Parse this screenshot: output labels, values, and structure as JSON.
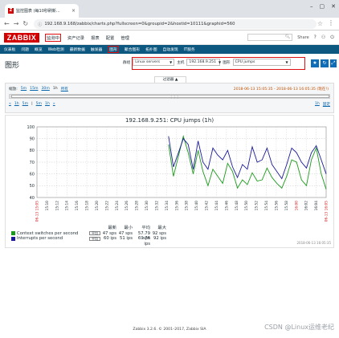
{
  "browser": {
    "tab_title": "监控图表 (每10秒刷新...",
    "url": "192.168.9.168/zabbix/charts.php?fullscreen=0&groupid=2&hostid=10111&graphid=560"
  },
  "header": {
    "logo": "ZABBIX",
    "menu": [
      "监测中",
      "资产记录",
      "报表",
      "配置",
      "管理"
    ],
    "share": "Share",
    "help": "?",
    "user": "⚇",
    "power": "⏻"
  },
  "submenu": [
    "仪表板",
    "问题",
    "概览",
    "Web检测",
    "最新数据",
    "触发器",
    "图形",
    "聚合图形",
    "拓扑图",
    "自动发现",
    "IT服务"
  ],
  "page": {
    "title": "图形",
    "group_label": "群组",
    "group_value": "Linux servers",
    "host_label": "主机",
    "host_value": "192.168.9.251",
    "graph_label": "图形",
    "graph_value": "CPU jumps"
  },
  "filter": {
    "tab_label": "过滤器 ▲",
    "zoom_label": "缩放:",
    "zoom_options": [
      "5m",
      "15m",
      "30m",
      "1h",
      "所有"
    ],
    "period": "2018-06-13 15:05:35 - 2018-06-13 16:05:35 (现在!)",
    "nav_left": [
      "«",
      "1h",
      "5m",
      "|",
      "5m",
      "1h",
      "»"
    ],
    "nav_right": "1h",
    "nav_fixed": "固定"
  },
  "graph": {
    "title": "192.168.9.251: CPU jumps (1h)",
    "legend_headers": [
      "最新",
      "最小",
      "平均",
      "最大"
    ],
    "generated": "2018-06-13 16:05:35"
  },
  "chart_data": {
    "type": "line",
    "title": "192.168.9.251: CPU jumps (1h)",
    "ylim": [
      40,
      100
    ],
    "yticks": [
      40,
      50,
      60,
      70,
      80,
      90,
      100
    ],
    "x_tick_labels": [
      "15:10",
      "15:12",
      "15:14",
      "15:16",
      "15:18",
      "15:20",
      "15:22",
      "15:24",
      "15:26",
      "15:28",
      "15:30",
      "15:32",
      "15:34",
      "15:36",
      "15:38",
      "15:40",
      "15:42",
      "15:44",
      "15:46",
      "15:48",
      "15:50",
      "15:52",
      "15:54",
      "15:56",
      "15:58",
      "16:00",
      "16:02",
      "16:04"
    ],
    "x_start_label": "06-13 15:05",
    "x_end_label": "06-13 16:05",
    "data_start_fraction": 0.455,
    "series": [
      {
        "name": "Context switches per second",
        "color": "#1a9a1a",
        "agg": "平均",
        "last": "47 sps",
        "min": "47 sps",
        "avg": "57.79 sps",
        "max": "92 sps",
        "values": [
          85,
          58,
          75,
          92,
          78,
          60,
          80,
          62,
          50,
          64,
          58,
          52,
          69,
          62,
          48,
          55,
          51,
          61,
          54,
          55,
          65,
          57,
          52,
          48,
          58,
          72,
          70,
          55,
          50,
          72,
          82,
          60,
          47
        ]
      },
      {
        "name": "Interrupts per second",
        "color": "#1a1a9a",
        "agg": "平均",
        "last": "60 ips",
        "min": "51 ips",
        "avg": "69.76 ips",
        "max": "92 ips",
        "values": [
          92,
          66,
          78,
          90,
          85,
          64,
          88,
          70,
          64,
          82,
          76,
          72,
          80,
          66,
          57,
          68,
          64,
          83,
          70,
          72,
          82,
          68,
          62,
          56,
          68,
          82,
          78,
          70,
          65,
          78,
          84,
          72,
          60
        ]
      }
    ]
  },
  "footer": "Zabbix 3.2.6. © 2001–2017, Zabbix SIA",
  "watermark": "CSDN @Linux运维老纪"
}
